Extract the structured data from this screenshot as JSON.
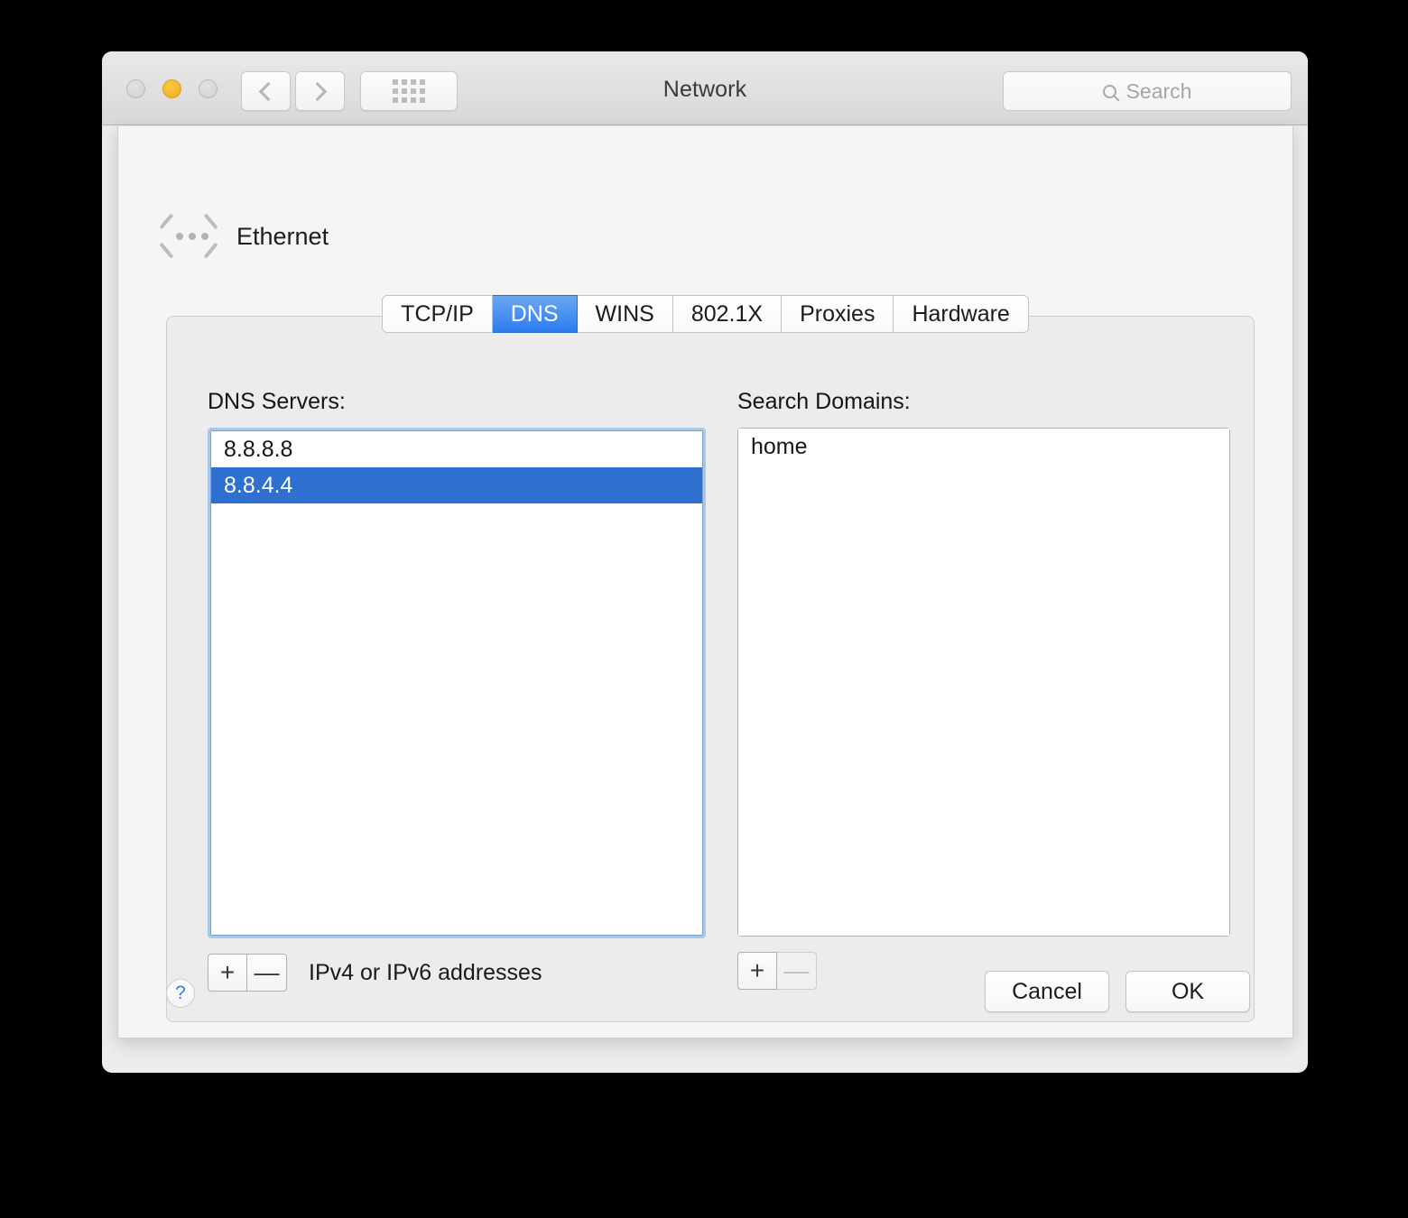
{
  "window": {
    "title": "Network",
    "traffic_lights": [
      "close",
      "minimize",
      "zoom"
    ],
    "nav": {
      "back": "back-chevron",
      "forward": "forward-chevron",
      "show_all": "grid-icon"
    },
    "search": {
      "placeholder": "Search",
      "value": "",
      "icon": "search-icon"
    }
  },
  "service": {
    "name": "Ethernet",
    "icon": "ethernet-icon"
  },
  "tabs": [
    {
      "label": "TCP/IP",
      "active": false
    },
    {
      "label": "DNS",
      "active": true
    },
    {
      "label": "WINS",
      "active": false
    },
    {
      "label": "802.1X",
      "active": false
    },
    {
      "label": "Proxies",
      "active": false
    },
    {
      "label": "Hardware",
      "active": false
    }
  ],
  "dns_servers": {
    "label": "DNS Servers:",
    "focused": true,
    "items": [
      {
        "value": "8.8.8.8",
        "selected": false
      },
      {
        "value": "8.8.4.4",
        "selected": true
      }
    ],
    "add_label": "+",
    "remove_label": "—",
    "remove_enabled": true,
    "hint": "IPv4 or IPv6 addresses"
  },
  "search_domains": {
    "label": "Search Domains:",
    "focused": false,
    "items": [
      {
        "value": "home",
        "selected": false
      }
    ],
    "add_label": "+",
    "remove_label": "—",
    "remove_enabled": false
  },
  "footer": {
    "help_label": "?",
    "cancel_label": "Cancel",
    "ok_label": "OK"
  },
  "colors": {
    "accent_selection": "#2f6fd0",
    "tab_active_top": "#6ba8f3",
    "tab_active_bottom": "#2b7bee",
    "focus_ring": "#a6c8ee",
    "help_blue": "#2d7ff0",
    "minimize_yellow": "#efab1e"
  }
}
